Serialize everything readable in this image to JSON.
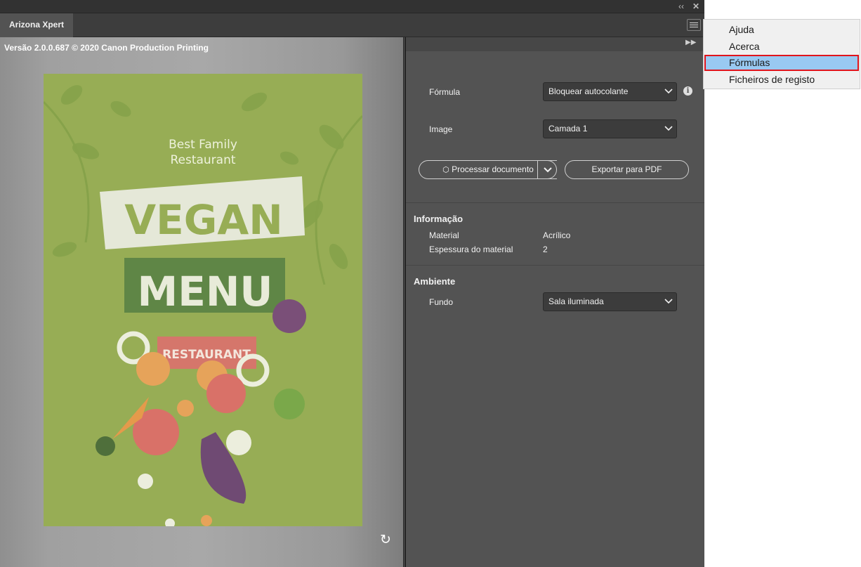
{
  "window": {
    "tab_label": "Arizona Xpert"
  },
  "preview": {
    "version_text": "Versão 2.0.0.687 © 2020 Canon Production Printing",
    "poster": {
      "line1": "Best Family",
      "line2": "Restaurant",
      "vegan": "VEGAN",
      "menu": "MENU",
      "restaurant": "RESTAURANT"
    }
  },
  "settings": {
    "formula": {
      "label": "Fórmula",
      "value": "Bloquear autocolante"
    },
    "image": {
      "label": "Image",
      "value": "Camada 1"
    },
    "process_button": "Processar documento",
    "export_button": "Exportar para PDF",
    "information": {
      "title": "Informação",
      "rows": [
        {
          "label": "Material",
          "value": "Acrílico"
        },
        {
          "label": "Espessura do material",
          "value": "2"
        }
      ]
    },
    "environment": {
      "title": "Ambiente",
      "background": {
        "label": "Fundo",
        "value": "Sala iluminada"
      }
    }
  },
  "menu": {
    "items": [
      {
        "label": "Ajuda"
      },
      {
        "label": "Acerca"
      },
      {
        "label": "Fórmulas"
      },
      {
        "label": "Ficheiros de registo"
      }
    ]
  }
}
